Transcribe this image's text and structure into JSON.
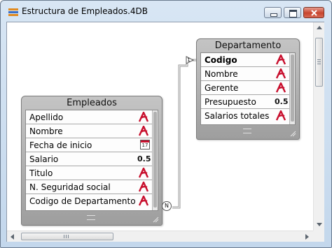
{
  "window": {
    "title": "Estructura de Empleados.4DB",
    "controls": [
      "minimize",
      "maximize",
      "close"
    ]
  },
  "icons": {
    "app": "database-structure-icon",
    "alpha": "alpha-field-icon",
    "date": "date-field-icon"
  },
  "colors": {
    "alpha_icon": "#c8102e",
    "table_header": "#b4b4b4",
    "close_button": "#c8452e"
  },
  "tables": {
    "empleados": {
      "name": "Empleados",
      "fields": [
        {
          "name": "Apellido",
          "type": "alpha",
          "bold": false
        },
        {
          "name": "Nombre",
          "type": "alpha",
          "bold": false
        },
        {
          "name": "Fecha de inicio",
          "type": "date",
          "type_label": "17",
          "bold": false
        },
        {
          "name": "Salario",
          "type": "real",
          "type_label": "0.5",
          "bold": false
        },
        {
          "name": "Titulo",
          "type": "alpha",
          "bold": false
        },
        {
          "name": "N. Seguridad social",
          "type": "alpha",
          "bold": false
        },
        {
          "name": "Codigo de Departamento",
          "type": "alpha",
          "bold": false
        }
      ]
    },
    "departamento": {
      "name": "Departamento",
      "fields": [
        {
          "name": "Codigo",
          "type": "alpha",
          "bold": true
        },
        {
          "name": "Nombre",
          "type": "alpha",
          "bold": false
        },
        {
          "name": "Gerente",
          "type": "alpha",
          "bold": false
        },
        {
          "name": "Presupuesto",
          "type": "real",
          "type_label": "0.5",
          "bold": false
        },
        {
          "name": "Salarios totales",
          "type": "alpha",
          "bold": false
        }
      ]
    }
  },
  "relation": {
    "many_label": "N",
    "one_label": "1"
  }
}
